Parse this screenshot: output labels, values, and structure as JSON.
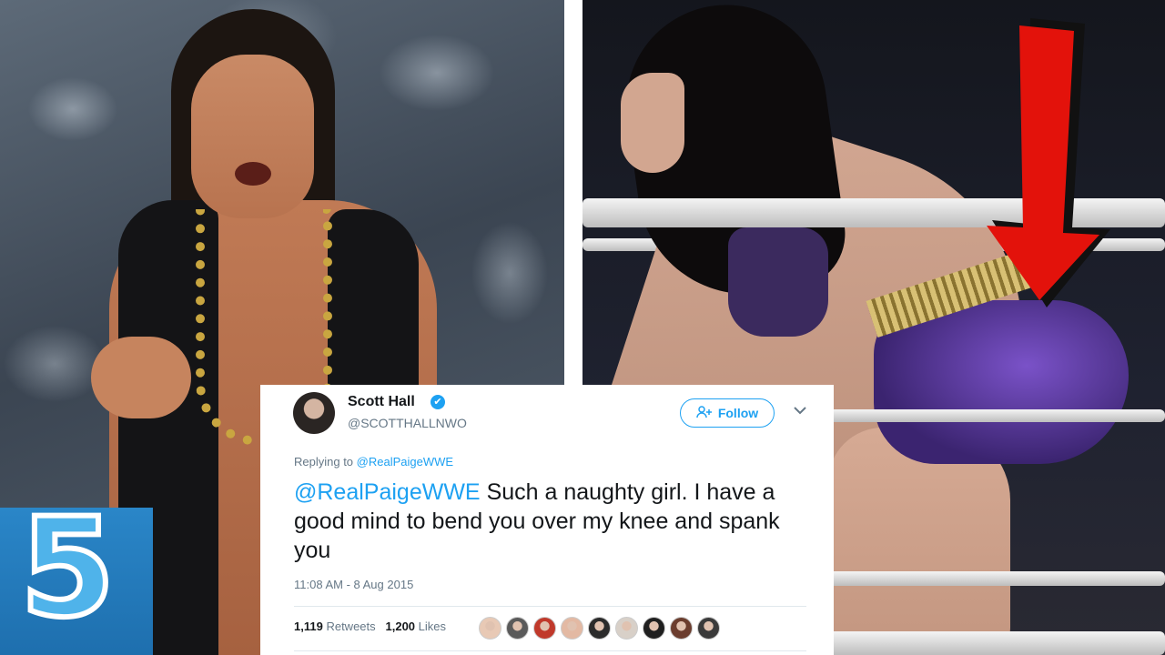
{
  "badge": {
    "number": "5"
  },
  "tweet": {
    "author_name": "Scott Hall",
    "verified_icon": "✔",
    "handle": "@SCOTTHALLNWO",
    "follow_label": "Follow",
    "replying_prefix": "Replying to",
    "replying_to": "@RealPaigeWWE",
    "mention": "@RealPaigeWWE",
    "body": "Such a naughty girl. I have a good mind to bend you over my knee and spank you",
    "timestamp": "11:08 AM - 8 Aug 2015",
    "retweets_count": "1,119",
    "retweets_label": "Retweets",
    "likes_count": "1,200",
    "likes_label": "Likes",
    "liker_colors": [
      "#e8c9b5",
      "#5a5a5a",
      "#c0392b",
      "#e3b9a3",
      "#2b2b2b",
      "#d8d0c8",
      "#1f1f1f",
      "#6b3d2e",
      "#3a3a3a"
    ]
  },
  "colors": {
    "accent": "#1da1f2",
    "arrow": "#e3120b",
    "badge": "#2a86c8"
  }
}
